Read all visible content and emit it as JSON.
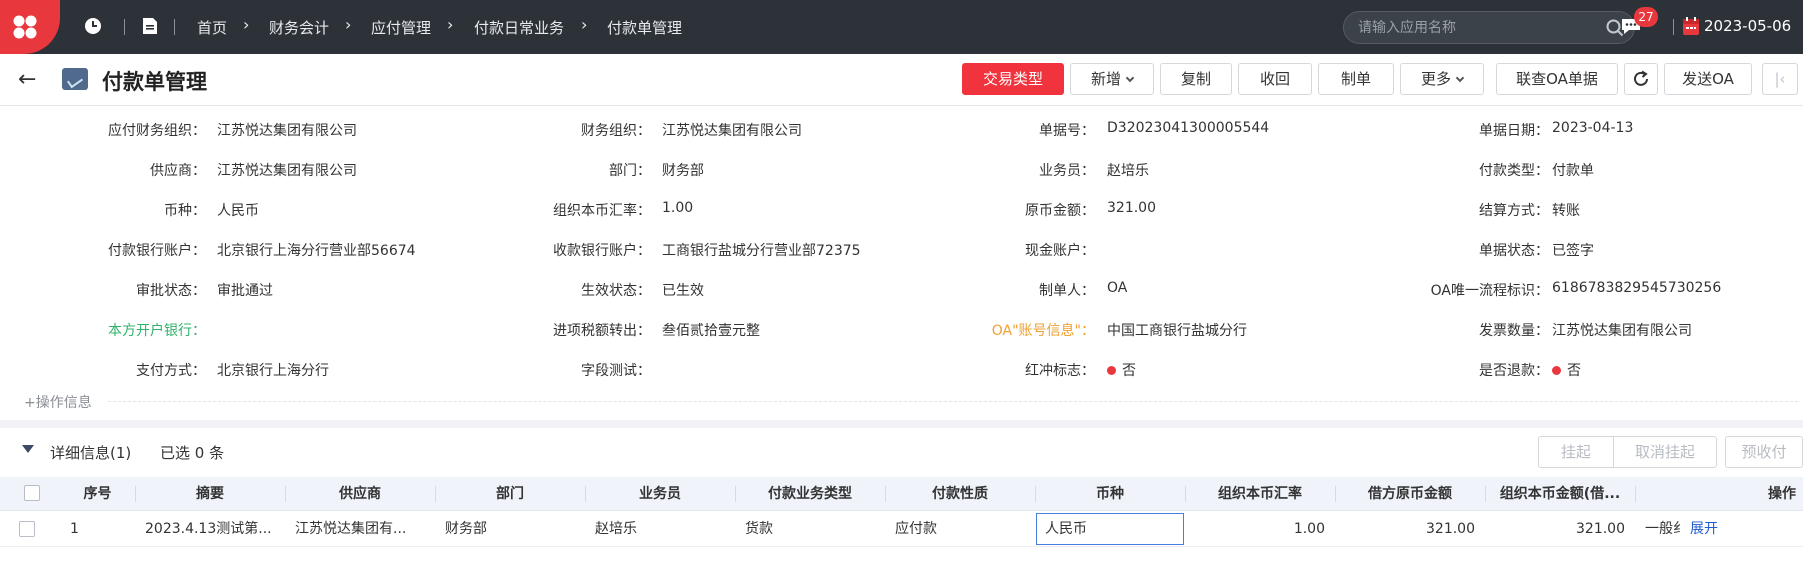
{
  "topbar": {
    "breadcrumb": [
      "首页",
      "财务会计",
      "应付管理",
      "付款日常业务",
      "付款单管理"
    ],
    "search_placeholder": "请输入应用名称",
    "message_count": "27",
    "date": "2023-05-06",
    "accent_color": "#e8383d"
  },
  "titlebar": {
    "title": "付款单管理",
    "buttons": {
      "trade_type": "交易类型",
      "add": "新增",
      "copy": "复制",
      "withdraw": "收回",
      "make": "制单",
      "more": "更多",
      "oa_query": "联查OA单据",
      "send_oa": "发送OA"
    }
  },
  "form": {
    "row1": [
      {
        "label": "应付财务组织：",
        "value": "江苏悦达集团有限公司"
      },
      {
        "label": "财务组织：",
        "value": "江苏悦达集团有限公司"
      },
      {
        "label": "单据号：",
        "value": "D32023041300005544"
      },
      {
        "label": "单据日期：",
        "value": "2023-04-13"
      }
    ],
    "row2": [
      {
        "label": "供应商：",
        "value": "江苏悦达集团有限公司"
      },
      {
        "label": "部门：",
        "value": "财务部"
      },
      {
        "label": "业务员：",
        "value": "赵培乐"
      },
      {
        "label": "付款类型：",
        "value": "付款单"
      }
    ],
    "row3": [
      {
        "label": "币种：",
        "value": "人民币"
      },
      {
        "label": "组织本币汇率：",
        "value": "1.00"
      },
      {
        "label": "原币金额：",
        "value": "321.00"
      },
      {
        "label": "结算方式：",
        "value": "转账"
      }
    ],
    "row4": [
      {
        "label": "付款银行账户：",
        "value": "北京银行上海分行营业部56674"
      },
      {
        "label": "收款银行账户：",
        "value": "工商银行盐城分行营业部72375"
      },
      {
        "label": "现金账户：",
        "value": ""
      },
      {
        "label": "单据状态：",
        "value": "已签字"
      }
    ],
    "row5": [
      {
        "label": "审批状态：",
        "value": "审批通过"
      },
      {
        "label": "生效状态：",
        "value": "已生效"
      },
      {
        "label": "制单人：",
        "value": "OA"
      },
      {
        "label": "OA唯一流程标识：",
        "value": "6186783829545730256"
      }
    ],
    "row6": [
      {
        "label": "本方开户银行：",
        "value": ""
      },
      {
        "label": "进项税额转出：",
        "value": "叁佰贰拾壹元整"
      },
      {
        "label": "OA\"账号信息\"：",
        "value": "中国工商银行盐城分行"
      },
      {
        "label": "发票数量：",
        "value": "江苏悦达集团有限公司"
      }
    ],
    "row7": [
      {
        "label": "支付方式：",
        "value": "北京银行上海分行"
      },
      {
        "label": "字段测试：",
        "value": ""
      },
      {
        "label": "红冲标志：",
        "value": "否"
      },
      {
        "label": "是否退款：",
        "value": "否"
      }
    ],
    "ops_info": "+操作信息"
  },
  "detail": {
    "title": "详细信息(1)",
    "selected": "已选 0 条",
    "buttons": {
      "suspend": "挂起",
      "cancel_suspend": "取消挂起",
      "prepay": "预收付"
    },
    "columns": [
      "序号",
      "摘要",
      "供应商",
      "部门",
      "业务员",
      "付款业务类型",
      "付款性质",
      "币种",
      "组织本币汇率",
      "借方原币金额",
      "组织本币金额(借...",
      "操作"
    ],
    "rows": [
      {
        "no": "1",
        "summary": "2023.4.13测试第...",
        "supplier": "江苏悦达集团有...",
        "dept": "财务部",
        "salesman": "赵培乐",
        "biz_type": "货款",
        "nature": "应付款",
        "currency": "人民币",
        "rate": "1.00",
        "debit_amount": "321.00",
        "org_amount": "321.00",
        "extra": "一般纟",
        "action": "展开"
      }
    ]
  }
}
